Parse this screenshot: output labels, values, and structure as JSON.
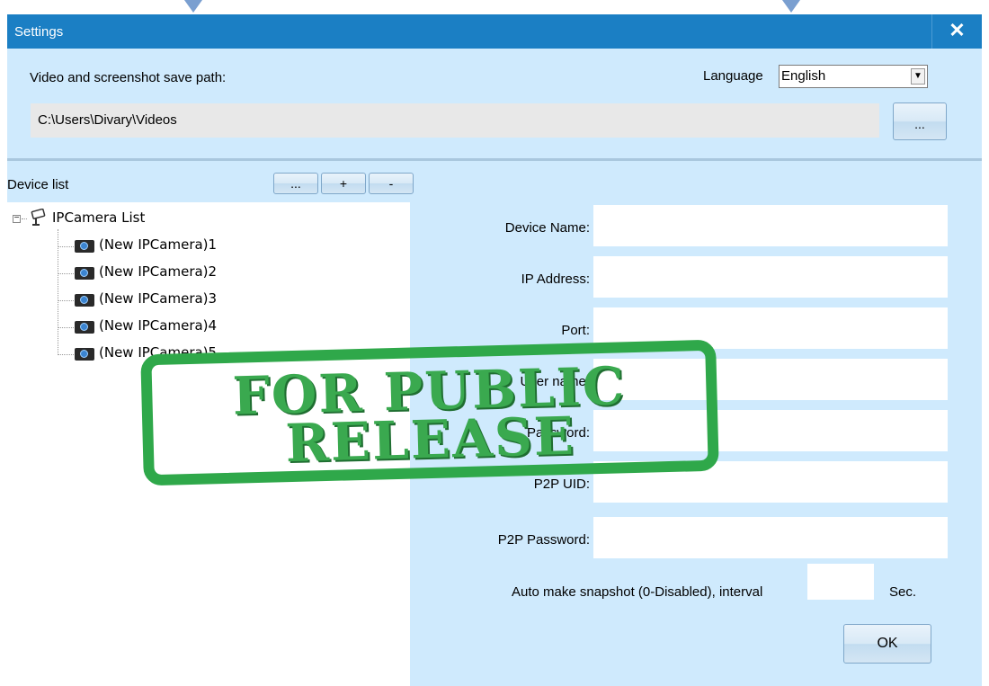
{
  "window": {
    "title": "Settings",
    "close_label": "✕"
  },
  "save_path": {
    "label": "Video and screenshot save path:",
    "value": "C:\\Users\\Divary\\Videos",
    "browse_label": "..."
  },
  "language": {
    "label": "Language",
    "selected": "English",
    "arrow": "▼"
  },
  "device_list": {
    "label": "Device list",
    "buttons": [
      "...",
      "+",
      "-"
    ],
    "root": "IPCamera List",
    "root_expander": "−",
    "items": [
      "(New IPCamera)1",
      "(New IPCamera)2",
      "(New IPCamera)3",
      "(New IPCamera)4",
      "(New IPCamera)5"
    ]
  },
  "form": {
    "device_name": "Device Name:",
    "ip_address": "IP Address:",
    "port": "Port:",
    "user_name": "User name:",
    "password": "Password:",
    "p2p_uid": "P2P UID:",
    "p2p_password": "P2P Password:"
  },
  "snapshot": {
    "label": "Auto make snapshot (0-Disabled), interval",
    "unit": "Sec."
  },
  "ok_label": "OK",
  "stamp": {
    "line1": "FOR PUBLIC",
    "line2": "RELEASE",
    "color": "#2fa84a"
  }
}
